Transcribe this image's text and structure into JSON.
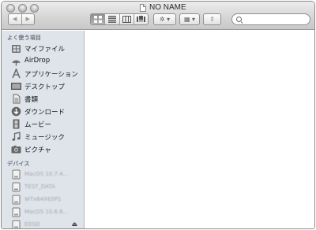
{
  "window": {
    "title": "NO NAME"
  },
  "toolbar": {
    "back_glyph": "◀",
    "forward_glyph": "▶",
    "action_glyph": "✲ ▾",
    "arrange_glyph": "▦ ▾",
    "share_glyph": "⇪",
    "view_modes": [
      "icon-view",
      "list-view",
      "column-view",
      "cover-flow-view"
    ],
    "active_view": "icon-view"
  },
  "search": {
    "value": "",
    "placeholder": ""
  },
  "sidebar": {
    "favorites_header": "よく使う項目",
    "favorites": [
      {
        "label": "マイファイル",
        "icon": "all-my-files-icon"
      },
      {
        "label": "AirDrop",
        "icon": "airdrop-icon"
      },
      {
        "label": "アプリケーション",
        "icon": "applications-icon"
      },
      {
        "label": "デスクトップ",
        "icon": "desktop-icon"
      },
      {
        "label": "書類",
        "icon": "documents-icon"
      },
      {
        "label": "ダウンロード",
        "icon": "downloads-icon"
      },
      {
        "label": "ムービー",
        "icon": "movies-icon"
      },
      {
        "label": "ミュージック",
        "icon": "music-icon"
      },
      {
        "label": "ピクチャ",
        "icon": "pictures-icon"
      }
    ],
    "devices_header": "デバイス",
    "devices": [
      {
        "label": "MacOS 10.7.4...",
        "icon": "disk-icon"
      },
      {
        "label": "TEST_DATA",
        "icon": "disk-icon"
      },
      {
        "label": "WTx64X65P1",
        "icon": "disk-icon"
      },
      {
        "label": "MacOS 10.6.8...",
        "icon": "disk-icon"
      },
      {
        "label": "EDSD",
        "icon": "disk-icon",
        "eject": "⏏"
      }
    ]
  }
}
